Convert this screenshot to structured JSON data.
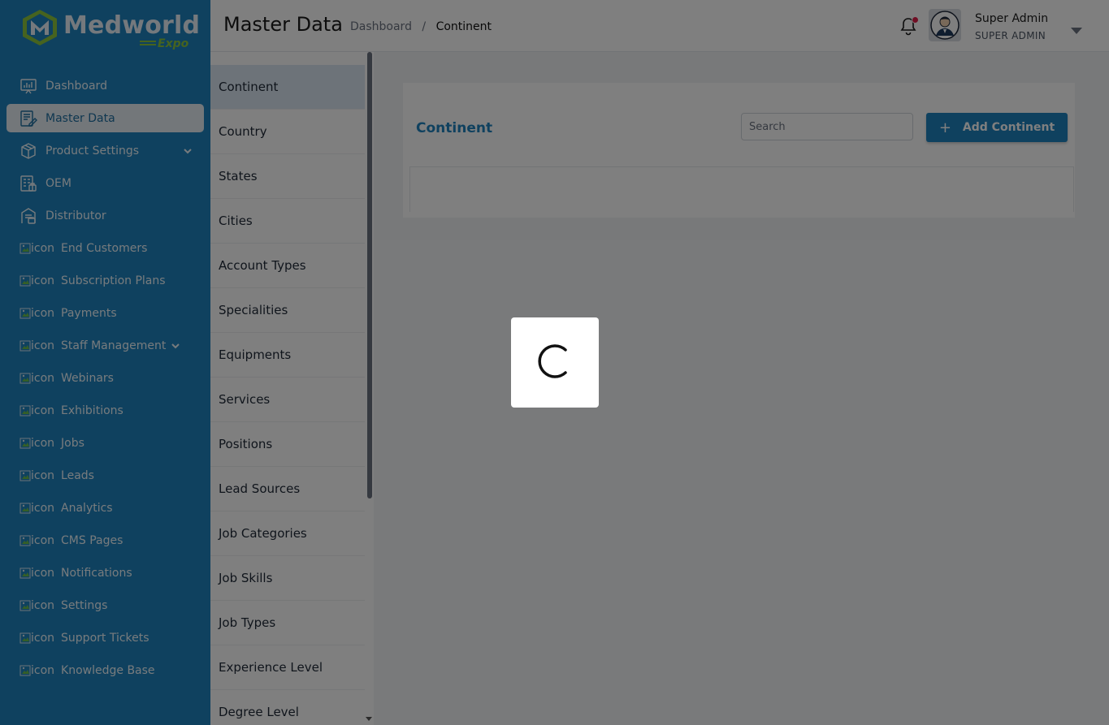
{
  "brand": {
    "name": "Medworld",
    "sub": "Expo"
  },
  "sidebar": {
    "items": [
      {
        "label": "Dashboard",
        "icon": "dashboard-icon"
      },
      {
        "label": "Master Data",
        "icon": "master-data-icon",
        "active": true
      },
      {
        "label": "Product Settings",
        "icon": "package-icon",
        "expandable": true
      },
      {
        "label": "OEM",
        "icon": "oem-icon"
      },
      {
        "label": "Distributor",
        "icon": "distributor-icon"
      }
    ],
    "broken_alt": "icon",
    "broken_items": [
      "End Customers",
      "Subscription Plans",
      "Payments",
      "Staff Management",
      "Webinars",
      "Exhibitions",
      "Jobs",
      "Leads",
      "Analytics",
      "CMS Pages",
      "Notifications",
      "Settings",
      "Support Tickets",
      "Knowledge Base"
    ]
  },
  "header": {
    "title": "Master Data",
    "breadcrumb": {
      "home": "Dashboard",
      "separator": "/",
      "current": "Continent"
    },
    "user": {
      "name": "Super Admin",
      "role": "SUPER ADMIN"
    }
  },
  "submenu": {
    "items": [
      "Continent",
      "Country",
      "States",
      "Cities",
      "Account Types",
      "Specialities",
      "Equipments",
      "Services",
      "Positions",
      "Lead Sources",
      "Job Categories",
      "Job Skills",
      "Job Types",
      "Experience Level",
      "Degree Level"
    ],
    "active_index": 0
  },
  "main": {
    "card_title": "Continent",
    "search_placeholder": "Search",
    "add_button_label": "Add Continent",
    "add_button_icon": "+"
  },
  "loader": {
    "visible": true
  },
  "colors": {
    "brand": "#1f83bf",
    "accent": "#8cc63f",
    "active_bg": "#e6eef4",
    "badge": "#e11d48"
  }
}
